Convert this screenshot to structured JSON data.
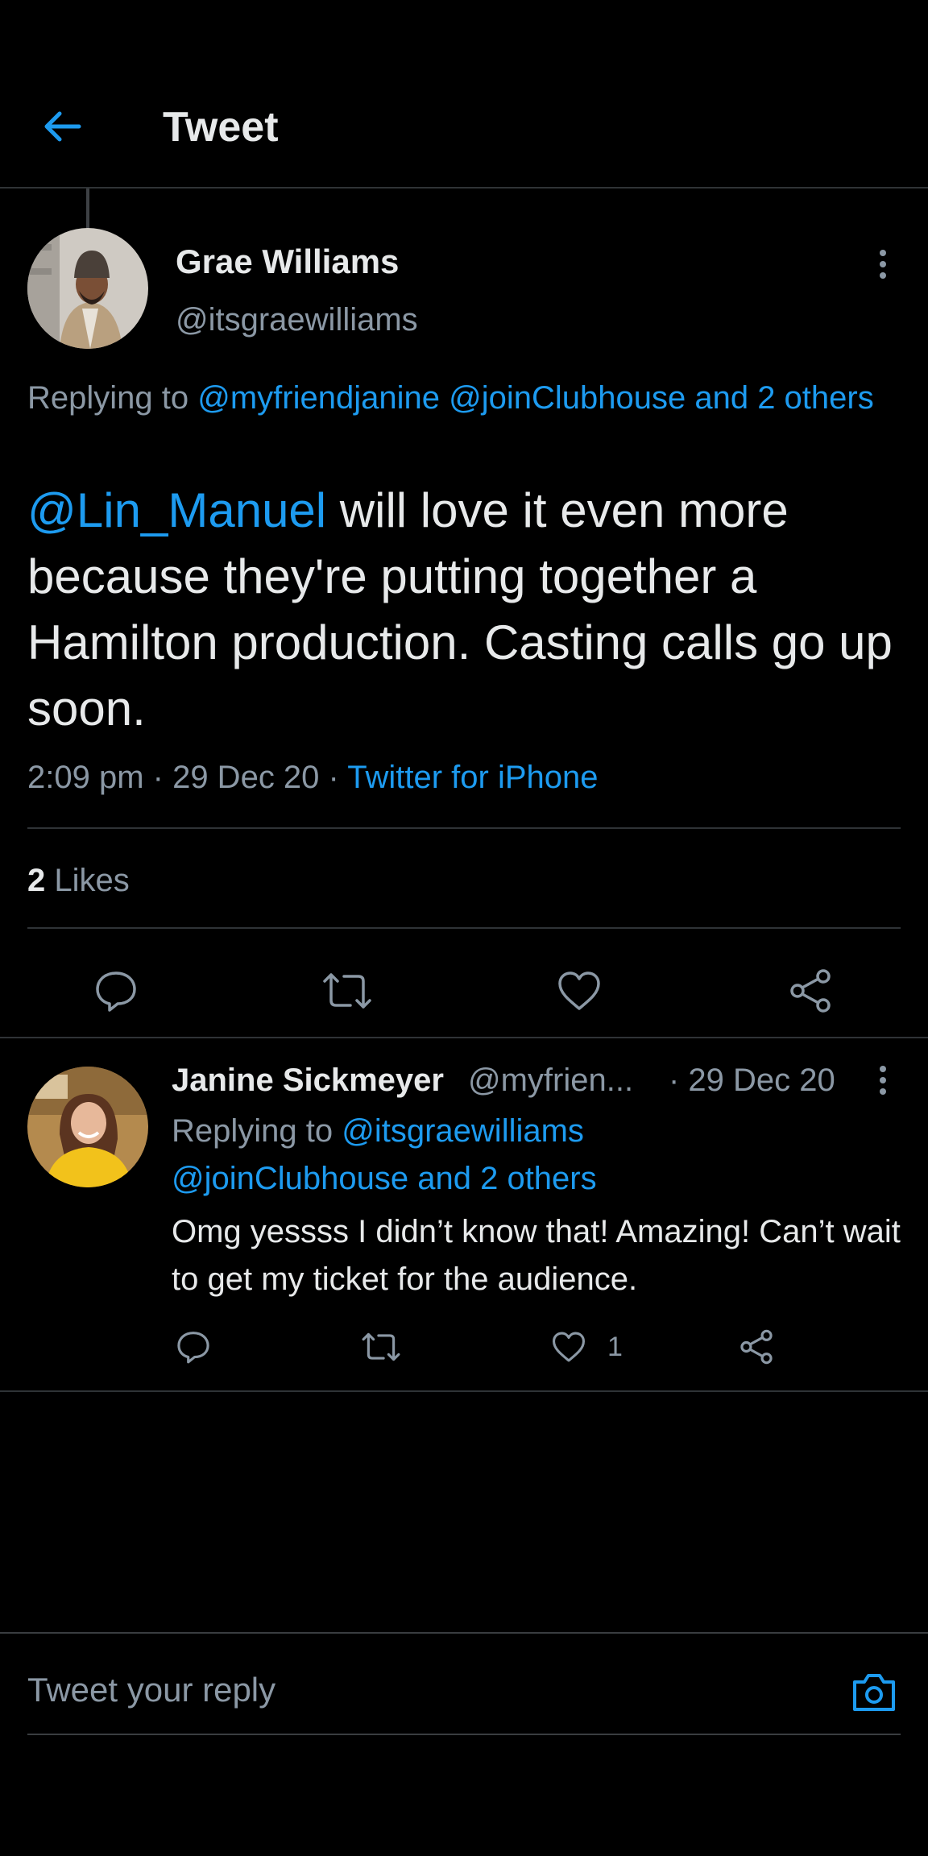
{
  "header": {
    "title": "Tweet",
    "back_icon": "arrow-left-icon"
  },
  "colors": {
    "accent": "#1d9bf0",
    "background": "#000000",
    "text_primary": "#e7e9ea",
    "text_secondary": "#8b98a5",
    "divider": "#2f3336"
  },
  "tweet": {
    "author_name": "Grae Williams",
    "author_handle": "@itsgraewilliams",
    "replying_prefix": "Replying to",
    "replying_links": "@myfriendjanine @joinClubhouse and 2 others",
    "mention": "@Lin_Manuel",
    "text_rest": " will love it even more because they're putting together a Hamilton production. Casting calls go up soon.",
    "time": "2:09 pm",
    "sep1": " · ",
    "date": "29 Dec 20",
    "sep2": " · ",
    "source": "Twitter for iPhone",
    "likes_count": "2",
    "likes_label": "Likes",
    "actions": [
      "reply-icon",
      "retweet-icon",
      "like-icon",
      "share-icon"
    ]
  },
  "reply": {
    "author_name": "Janine Sickmeyer",
    "author_handle": "@myfrien...",
    "date": "· 29 Dec 20",
    "replying_prefix": "Replying to",
    "replying_link1": "@itsgraewilliams",
    "replying_link2": "@joinClubhouse and 2 others",
    "text": "Omg yessss I didn’t know that! Amazing! Can’t wait to get my ticket for the audience.",
    "like_count": "1"
  },
  "compose": {
    "placeholder": "Tweet your reply",
    "camera_icon": "camera-icon"
  }
}
